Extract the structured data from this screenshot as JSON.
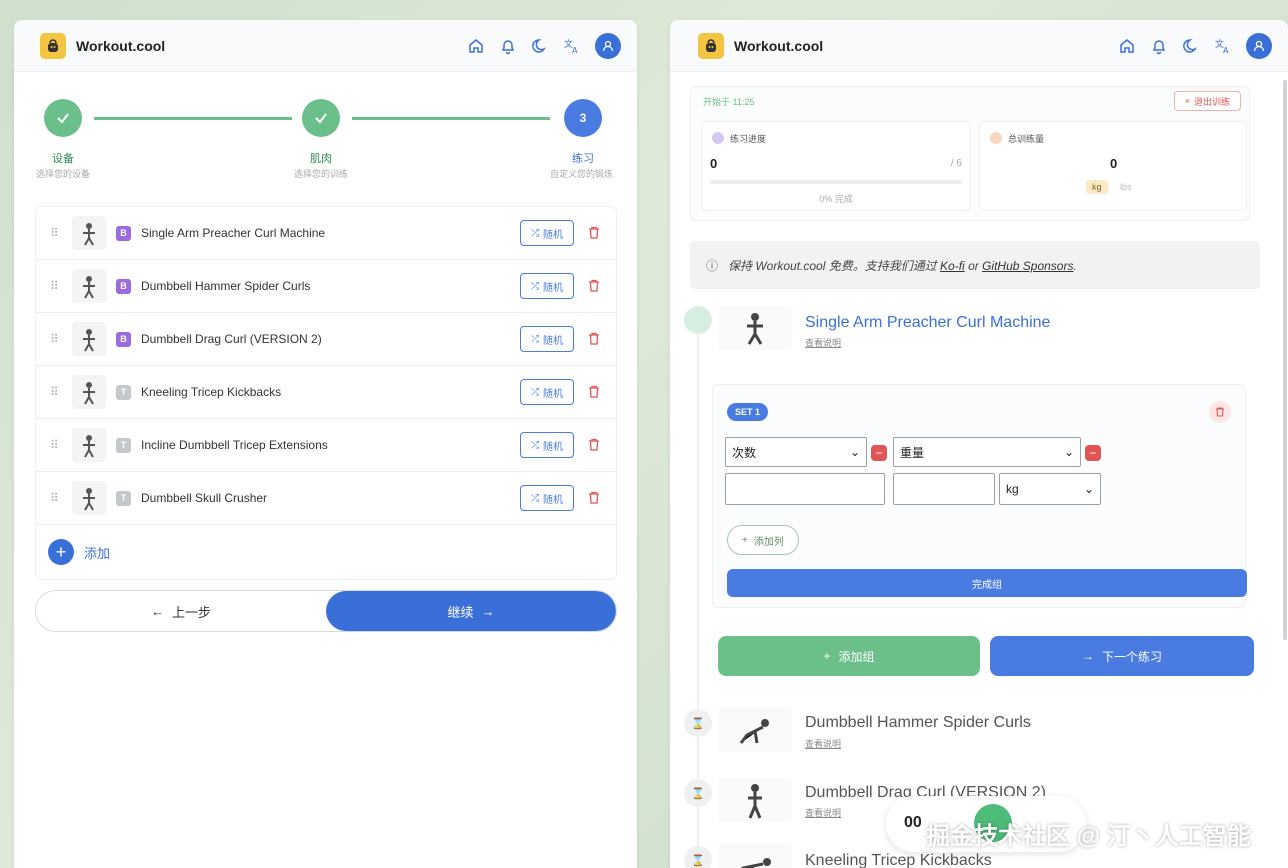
{
  "app": {
    "name": "Workout.cool"
  },
  "colors": {
    "primary": "#3b6fd8",
    "success": "#6bbf8a",
    "danger": "#e05555",
    "purple_badge": "#9b6be0",
    "gray_badge": "#c4c7cc"
  },
  "left": {
    "steps": [
      {
        "label": "设备",
        "sub": "选择您的设备",
        "state": "done"
      },
      {
        "label": "肌肉",
        "sub": "选择您的训练",
        "state": "done"
      },
      {
        "label": "练习",
        "sub": "自定义您的锻炼",
        "state": "current",
        "number": "3"
      }
    ],
    "exercises": [
      {
        "name": "Single Arm Preacher Curl Machine",
        "badge": "B",
        "badge_type": "purple"
      },
      {
        "name": "Dumbbell Hammer Spider Curls",
        "badge": "B",
        "badge_type": "purple"
      },
      {
        "name": "Dumbbell Drag Curl (VERSION 2)",
        "badge": "B",
        "badge_type": "purple"
      },
      {
        "name": "Kneeling Tricep Kickbacks",
        "badge": "T",
        "badge_type": "gray"
      },
      {
        "name": "Incline Dumbbell Tricep Extensions",
        "badge": "T",
        "badge_type": "gray"
      },
      {
        "name": "Dumbbell Skull Crusher",
        "badge": "T",
        "badge_type": "gray"
      }
    ],
    "shuffle_label": "随机",
    "add_label": "添加",
    "prev_label": "上一步",
    "next_label": "继续"
  },
  "right": {
    "started_text": "开始于 11:25",
    "quit_label": "退出训练",
    "progress_card": {
      "title": "练习进度",
      "value": "0",
      "total": "/ 6",
      "percent_text": "0% 完成",
      "progress_fraction": 0
    },
    "volume_card": {
      "title": "总训练量",
      "value": "0",
      "unit_kg": "kg",
      "unit_lbs": "lbs"
    },
    "support": {
      "prefix": "保持 Workout.cool 免费。支持我们通过 ",
      "link1": "Ko-fi",
      "or": " or ",
      "link2": "GitHub Sponsors",
      "suffix": "."
    },
    "current_exercise": {
      "name": "Single Arm Preacher Curl Machine",
      "link": "查看说明"
    },
    "set": {
      "badge": "SET 1",
      "col1_select": "次数",
      "col2_select": "重量",
      "unit_select": "kg",
      "add_column": "添加列",
      "finish": "完成组"
    },
    "add_set": "添加组",
    "next_exercise": "下一个练习",
    "upcoming": [
      {
        "name": "Dumbbell Hammer Spider Curls",
        "link": "查看说明"
      },
      {
        "name": "Dumbbell Drag Curl (VERSION 2)",
        "link": "查看说明"
      },
      {
        "name": "Kneeling Tricep Kickbacks",
        "link": ""
      }
    ],
    "timer": "00"
  },
  "watermark": "掘金技术社区 @ 汀丶人工智能"
}
